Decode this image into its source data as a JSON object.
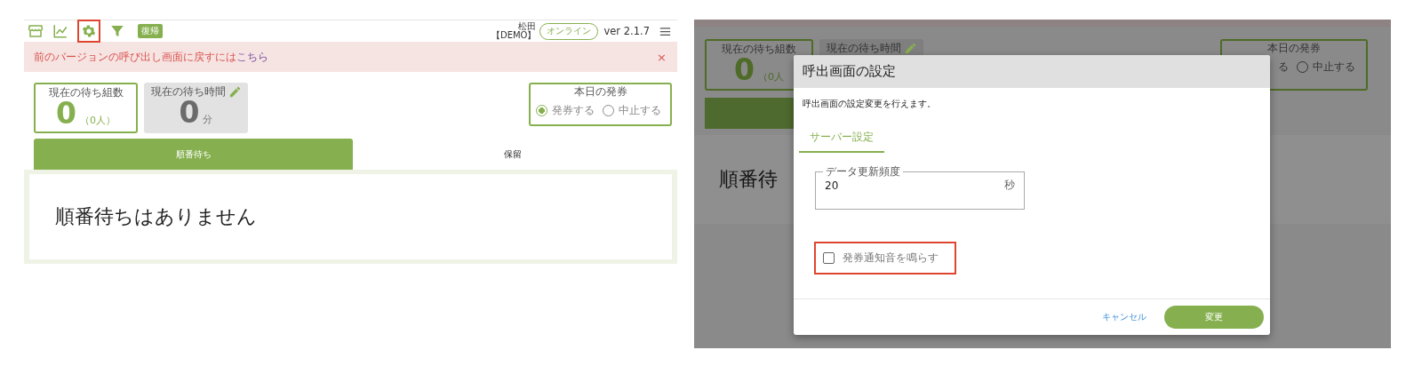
{
  "left_screen": {
    "toolbar": {
      "icons": [
        {
          "kind": "store",
          "highlighted": false
        },
        {
          "kind": "chart",
          "highlighted": false
        },
        {
          "kind": "settings",
          "highlighted": true
        },
        {
          "kind": "filter",
          "highlighted": false
        }
      ],
      "badge": "復帰",
      "user_name": "松田",
      "user_tag": "【DEMO】",
      "status": "オンライン",
      "version": "ver 2.1.7"
    },
    "alert": {
      "text": "前のバージョンの呼び出し画面に戻すには",
      "link": "こちら",
      "close": "×"
    },
    "wait_groups": {
      "label": "現在の待ち組数",
      "value": "0",
      "sub": "（0人）"
    },
    "wait_time": {
      "label": "現在の待ち時間",
      "value": "0",
      "unit": "分"
    },
    "ticketing": {
      "label": "本日の発券",
      "options": [
        {
          "label": "発券する",
          "selected": true
        },
        {
          "label": "中止する",
          "selected": false
        }
      ]
    },
    "tabs": [
      {
        "label": "順番待ち",
        "selected": true
      },
      {
        "label": "保留",
        "selected": false
      }
    ],
    "empty_message": "順番待ちはありません"
  },
  "right_screen": {
    "background": {
      "wait_groups": {
        "label": "現在の待ち組数",
        "value": "0",
        "sub": "（0人"
      },
      "wait_time": {
        "label": "現在の待ち時間"
      },
      "ticketing": {
        "label": "本日の発券",
        "partial_option": "る",
        "options": [
          {
            "label": "中止する",
            "selected": false
          }
        ]
      },
      "tabs": [
        {
          "selected": true
        }
      ],
      "empty_message": "順番待"
    },
    "dialog": {
      "title": "呼出画面の設定",
      "description": "呼出画面の設定変更を行えます。",
      "tabs": [
        {
          "label": "サーバー設定",
          "selected": true
        }
      ],
      "field": {
        "label": "データ更新頻度",
        "value": "20",
        "unit": "秒"
      },
      "checkbox": {
        "label": "発券通知音を鳴らす",
        "checked": false,
        "highlighted": true
      },
      "buttons": [
        {
          "label": "キャンセル",
          "kind": "text"
        },
        {
          "label": "変更",
          "kind": "primary"
        }
      ]
    }
  }
}
